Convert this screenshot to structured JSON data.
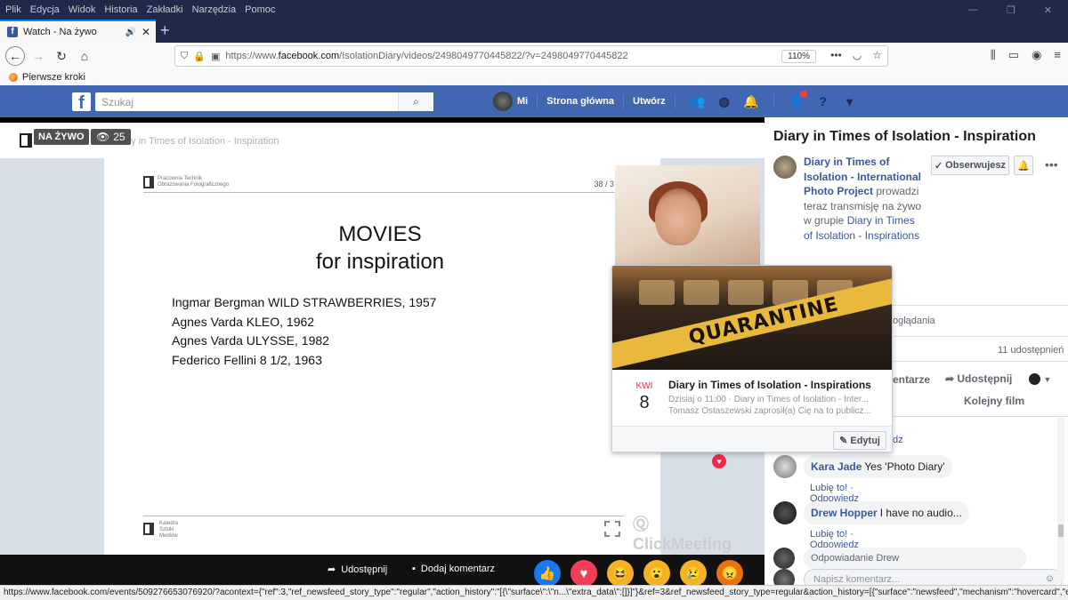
{
  "browser": {
    "menu": [
      "Plik",
      "Edycja",
      "Widok",
      "Historia",
      "Zakładki",
      "Narzędzia",
      "Pomoc"
    ],
    "tab_title": "Watch - Na żywo",
    "url_prefix": "https://www.",
    "url_host": "facebook.com",
    "url_path": "/IsolationDiary/videos/2498049770445822/?v=2498049770445822",
    "zoom": "110%",
    "bookmark": "Pierwsze kroki",
    "status_url": "https://www.facebook.com/events/509276653076920/?acontext={\"ref\":3,\"ref_newsfeed_story_type\":\"regular\",\"action_history\":\"[{\\\"surface\\\":\\\"n...\\\"extra_data\\\":[]}]\"}&ref=3&ref_newsfeed_story_type=regular&action_history=[{\"surface\":\"newsfeed\",\"mechanism\":\"hovercard\",\"extra_data\":[]}]"
  },
  "fb": {
    "search_placeholder": "Szukaj",
    "user_name": "Mi",
    "home": "Strona główna",
    "create": "Utwórz"
  },
  "video": {
    "live_label": "NA ŻYWO",
    "viewers": "25",
    "header_text": "Diary in Times of Isolation - Inspiration",
    "slide": {
      "org_line1": "Pracownia Technik",
      "org_line2": "Obrazowania Fotograficznego",
      "page": "38 / 3",
      "title1": "MOVIES",
      "title2": "for inspiration",
      "items": [
        "Ingmar Bergman WILD STRAWBERRIES, 1957",
        "Agnes Varda KLEO, 1962",
        "Agnes Varda ULYSSE, 1982",
        "Federico Fellini 8 1/2, 1963"
      ],
      "footer_line1": "Katedra",
      "footer_line2": "Sztuki",
      "footer_line3": "Mediów",
      "watermark": "ClickMeeting"
    },
    "share": "Udostępnij",
    "add_comment": "Dodaj komentarz"
  },
  "sidebar": {
    "title": "Diary in Times of Isolation - Inspiration",
    "page_name": "Diary in Times of Isolation - International Photo Project",
    "desc_mid": " prowadzi teraz transmisję na żywo w grupie ",
    "group_name": "Diary in Times of Isolation - Inspirations",
    "follow": "Obserwujesz",
    "views_partial": "oglądania",
    "shares": "11 udostępnień",
    "comment_action": "entarze",
    "share_action": "Udostępnij",
    "next_video": "Kolejny film",
    "partial_link": "dz",
    "comments": [
      {
        "name": "Kara Jade",
        "text": "Yes 'Photo Diary'",
        "like": "Lubię to!",
        "reply": "Odpowiedz"
      },
      {
        "name": "Drew Hopper",
        "text": "I have no audio...",
        "like": "Lubię to!",
        "reply": "Odpowiedz"
      }
    ],
    "reply_preview": "Odpowiadanie Drew",
    "composer_placeholder": "Napisz komentarz..."
  },
  "popup": {
    "month": "KWI",
    "day": "8",
    "cover_text": "QUARANTINE",
    "event_title": "Diary in Times of Isolation - Inspirations",
    "event_sub1": "Dzisiaj o 11:00 · Diary in Times of Isolation - Inter...",
    "event_sub2": "Tomasz Ostaszewski zaprosił(a) Cię na to publicz...",
    "edit": "Edytuj"
  }
}
